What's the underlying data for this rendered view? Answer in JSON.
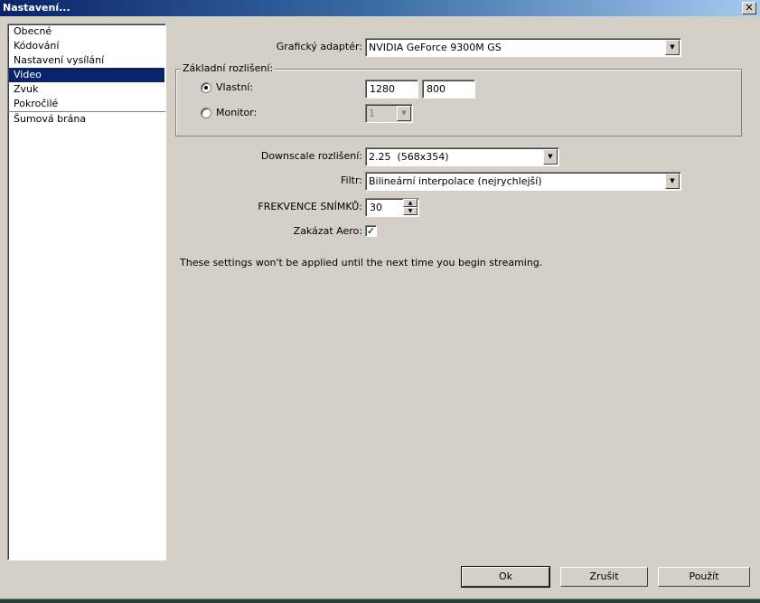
{
  "window": {
    "title": "Nastavení...",
    "close_label": "✕"
  },
  "sidebar": {
    "items": [
      {
        "label": "Obecné"
      },
      {
        "label": "Kódování"
      },
      {
        "label": "Nastavení vysílání"
      },
      {
        "label": "Video",
        "selected": true
      },
      {
        "label": "Zvuk"
      },
      {
        "label": "Pokročilé"
      },
      {
        "label": "Šumová brána"
      }
    ]
  },
  "video": {
    "adapter_label": "Grafický adaptér:",
    "adapter_value": "NVIDIA GeForce 9300M GS",
    "base_res_legend": "Základní rozlišení:",
    "custom_label": "Vlastní:",
    "custom_width": "1280",
    "custom_height": "800",
    "monitor_label": "Monitor:",
    "monitor_value": "1",
    "downscale_label": "Downscale rozlišení:",
    "downscale_value": "2.25  (568x354)",
    "filter_label": "Filtr:",
    "filter_value": "Bilineární interpolace (nejrychlejší)",
    "fps_label": "FREKVENCE SNÍMKŮ:",
    "fps_value": "30",
    "aero_label": "Zakázat Aero:",
    "aero_checked": true,
    "aero_check": "✓",
    "note": "These settings won't be applied until the next time you begin streaming."
  },
  "buttons": {
    "ok": "Ok",
    "cancel": "Zrušit",
    "apply": "Použít"
  }
}
